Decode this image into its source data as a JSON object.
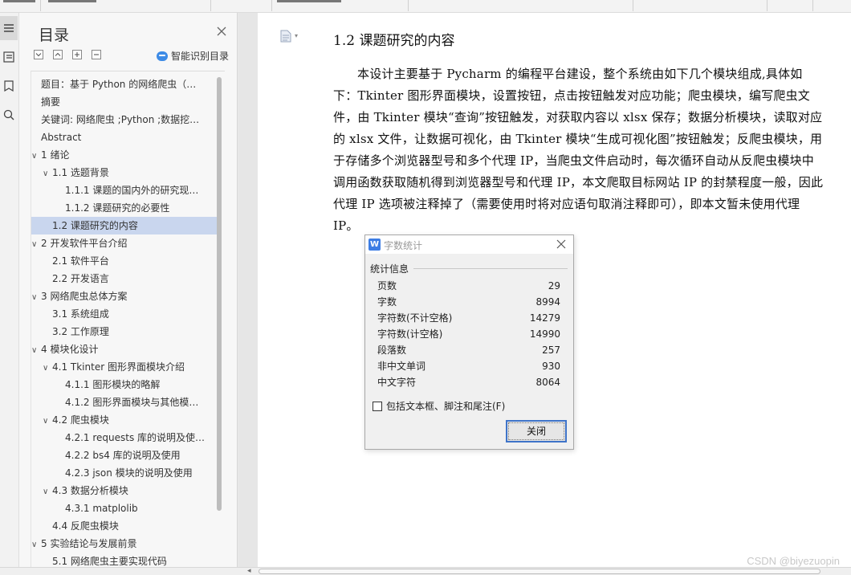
{
  "toc": {
    "title": "目录",
    "smart_label": "智能识别目录",
    "items": [
      {
        "label": "题目：基于 Python 的网络爬虫（…",
        "level": 0,
        "chevron": ""
      },
      {
        "label": "摘要",
        "level": 0,
        "chevron": ""
      },
      {
        "label": "关键词: 网络爬虫 ;Python ;数据挖…",
        "level": 0,
        "chevron": ""
      },
      {
        "label": "Abstract",
        "level": 0,
        "chevron": ""
      },
      {
        "label": "1  绪论",
        "level": 0,
        "chevron": "∨"
      },
      {
        "label": "1.1 选题背景",
        "level": 1,
        "chevron": "∨"
      },
      {
        "label": "1.1.1 课题的国内外的研究现…",
        "level": 2,
        "chevron": ""
      },
      {
        "label": "1.1.2 课题研究的必要性",
        "level": 2,
        "chevron": ""
      },
      {
        "label": "1.2 课题研究的内容",
        "level": 1,
        "chevron": "",
        "selected": true
      },
      {
        "label": "2 开发软件平台介绍",
        "level": 0,
        "chevron": "∨"
      },
      {
        "label": "2.1   软件平台",
        "level": 1,
        "chevron": ""
      },
      {
        "label": "2.2   开发语言",
        "level": 1,
        "chevron": ""
      },
      {
        "label": "3 网络爬虫总体方案",
        "level": 0,
        "chevron": "∨"
      },
      {
        "label": "3.1   系统组成",
        "level": 1,
        "chevron": ""
      },
      {
        "label": "3.2   工作原理",
        "level": 1,
        "chevron": ""
      },
      {
        "label": "4 模块化设计",
        "level": 0,
        "chevron": "∨"
      },
      {
        "label": "4.1   Tkinter 图形界面模块介绍",
        "level": 1,
        "chevron": "∨"
      },
      {
        "label": "4.1.1 图形模块的略解",
        "level": 2,
        "chevron": ""
      },
      {
        "label": "4.1.2 图形界面模块与其他模…",
        "level": 2,
        "chevron": ""
      },
      {
        "label": "4.2   爬虫模块",
        "level": 1,
        "chevron": "∨"
      },
      {
        "label": "4.2.1 requests 库的说明及使…",
        "level": 2,
        "chevron": ""
      },
      {
        "label": "4.2.2 bs4 库的说明及使用",
        "level": 2,
        "chevron": ""
      },
      {
        "label": "4.2.3 json 模块的说明及使用",
        "level": 2,
        "chevron": ""
      },
      {
        "label": "4.3    数据分析模块",
        "level": 1,
        "chevron": "∨"
      },
      {
        "label": "4.3.1 matplolib",
        "level": 2,
        "chevron": ""
      },
      {
        "label": "4.4    反爬虫模块",
        "level": 1,
        "chevron": ""
      },
      {
        "label": "5 实验结论与发展前景",
        "level": 0,
        "chevron": "∨"
      },
      {
        "label": "5.1 网络爬虫主要实现代码",
        "level": 1,
        "chevron": ""
      }
    ]
  },
  "document": {
    "heading": "1.2 课题研究的内容",
    "paragraph": "本设计主要基于 Pycharm 的编程平台建设，整个系统由如下几个模块组成,具体如下：Tkinter 图形界面模块，设置按钮，点击按钮触发对应功能；爬虫模块，编写爬虫文件，由 Tkinter 模块“查询”按钮触发，对获取内容以 xlsx 保存；数据分析模块，读取对应的 xlsx 文件，让数据可视化，由 Tkinter 模块“生成可视化图”按钮触发；反爬虫模块，用于存储多个浏览器型号和多个代理 IP，当爬虫文件启动时，每次循环自动从反爬虫模块中调用函数获取随机得到浏览器型号和代理 IP，本文爬取目标网站 IP 的封禁程度一般，因此代理 IP 选项被注释掉了（需要使用时将对应语句取消注释即可），即本文暂未使用代理 IP。"
  },
  "dialog": {
    "title": "字数统计",
    "app_icon_letter": "W",
    "group_label": "统计信息",
    "stats": [
      {
        "key": "页数",
        "value": "29"
      },
      {
        "key": "字数",
        "value": "8994"
      },
      {
        "key": "字符数(不计空格)",
        "value": "14279"
      },
      {
        "key": "字符数(计空格)",
        "value": "14990"
      },
      {
        "key": "段落数",
        "value": "257"
      },
      {
        "key": "非中文单词",
        "value": "930"
      },
      {
        "key": "中文字符",
        "value": "8064"
      }
    ],
    "checkbox_label": "包括文本框、脚注和尾注(F)",
    "checkbox_checked": false,
    "close_label": "关闭"
  },
  "watermark": "CSDN @biyezuopin",
  "colors": {
    "selected_item": "#c9d6ee",
    "accent_blue": "#3d7de4"
  }
}
